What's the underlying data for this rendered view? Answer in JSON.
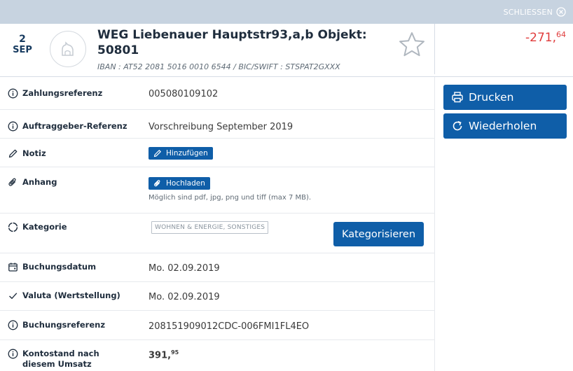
{
  "topbar": {
    "close_label": "SCHLIESSEN"
  },
  "header": {
    "day": "2",
    "month": "SEP",
    "title": "WEG Liebenauer Hauptstr93,a,b Objekt: 50801",
    "iban_line": "IBAN : AT52 2081 5016 0010 6544 / BIC/SWIFT : STSPAT2GXXX",
    "amount_main": "-271,",
    "amount_cents": "64"
  },
  "details": {
    "zahlungsreferenz": {
      "label": "Zahlungsreferenz",
      "value": "005080109102"
    },
    "auftraggeber": {
      "label": "Auftraggeber-Referenz",
      "value": "Vorschreibung September 2019"
    },
    "notiz": {
      "label": "Notiz",
      "button": "Hinzufügen"
    },
    "anhang": {
      "label": "Anhang",
      "button": "Hochladen",
      "hint": "Möglich sind pdf, jpg, png und tiff (max 7 MB)."
    },
    "kategorie": {
      "label": "Kategorie",
      "tag": "WOHNEN & ENERGIE, SONSTIGES",
      "button": "Kategorisieren"
    },
    "buchungsdatum": {
      "label": "Buchungsdatum",
      "value": "Mo. 02.09.2019"
    },
    "valuta": {
      "label": "Valuta (Wertstellung)",
      "value": "Mo. 02.09.2019"
    },
    "buchungsreferenz": {
      "label": "Buchungsreferenz",
      "value": "208151909012CDC-006FMI1FL4EO"
    },
    "kontostand": {
      "label": "Kontostand nach diesem Umsatz",
      "value_main": "391,",
      "value_cents": "95"
    }
  },
  "actions": {
    "print": "Drucken",
    "repeat": "Wiederholen"
  },
  "colors": {
    "primary": "#0f5ea8",
    "negative": "#e03c3c",
    "positive": "#2f9e44",
    "topbar": "#c7d3e0"
  }
}
